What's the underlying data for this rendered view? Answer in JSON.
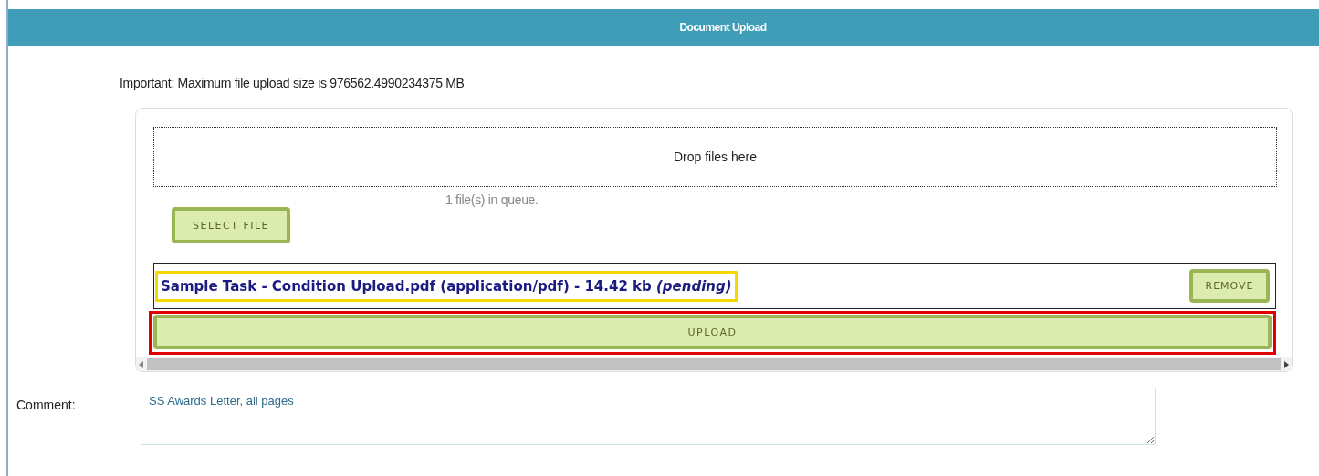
{
  "header": {
    "title": "Document Upload"
  },
  "notice": "Important: Maximum file upload size is 976562.4990234375 MB",
  "uploader": {
    "dropzone": "Drop files here",
    "queue_status": "1 file(s) in queue.",
    "select_button": "SELECT FILE",
    "files": [
      {
        "description": "Sample Task - Condition Upload.pdf (application/pdf) - 14.42 kb *(pending)*",
        "remove_button": "REMOVE"
      }
    ],
    "upload_button": "UPLOAD"
  },
  "comment": {
    "label": "Comment:",
    "value": "SS Awards Letter, all pages"
  }
}
